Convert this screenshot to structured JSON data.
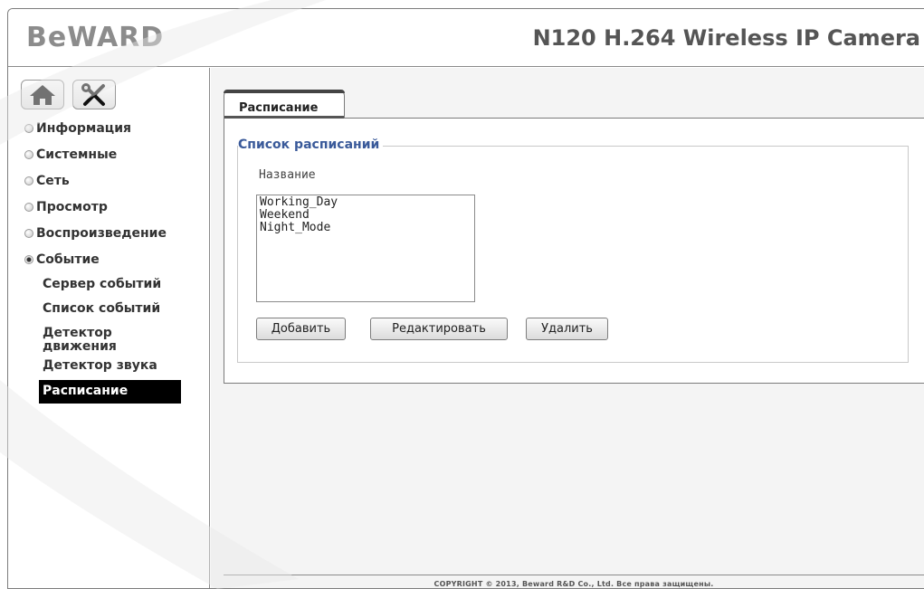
{
  "header": {
    "logo": "BeWARD",
    "product": "N120 H.264 Wireless IP Camera"
  },
  "sidebar": {
    "icons": [
      "home-icon",
      "tools-icon"
    ],
    "items": [
      {
        "label": "Информация"
      },
      {
        "label": "Системные"
      },
      {
        "label": "Сеть"
      },
      {
        "label": "Просмотр"
      },
      {
        "label": "Воспроизведение"
      },
      {
        "label": "Событие"
      }
    ],
    "subitems": [
      {
        "label": "Сервер событий"
      },
      {
        "label": "Список событий"
      },
      {
        "label": "Детектор движения"
      },
      {
        "label": "Детектор звука"
      },
      {
        "label": "Расписание"
      }
    ]
  },
  "main": {
    "tab": "Расписание",
    "legend": "Список расписаний",
    "column": "Название",
    "schedules": [
      "Working_Day",
      "Weekend",
      "Night_Mode"
    ],
    "buttons": {
      "add": "Добавить",
      "edit": "Редактировать",
      "delete": "Удалить"
    }
  },
  "footer": "COPYRIGHT © 2013, Beward R&D Co., Ltd. Все права защищены.",
  "colors": {
    "accent_legend": "#3a5a9a",
    "active_nav_bg": "#000000"
  }
}
